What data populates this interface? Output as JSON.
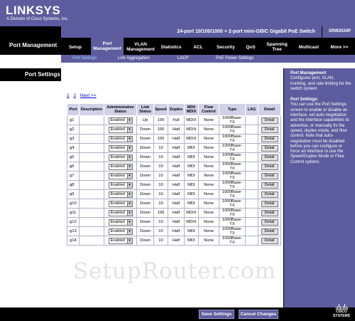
{
  "brand": {
    "logo": "LINKSYS",
    "sub": "A Division of Cisco Systems, Inc."
  },
  "section_title": "Port Management",
  "product": {
    "name": "24-port 10/100/1000 + 2-port mini-GBIC Gigabit PoE Switch",
    "model": "SRW2024P"
  },
  "tabs": [
    "Setup",
    "Port Management",
    "VLAN Management",
    "Statistics",
    "ACL",
    "Security",
    "QoS",
    "Spanning Tree",
    "Multicast",
    "More >>"
  ],
  "subnav": [
    "Port Settings",
    "Link Aggregation",
    "LACP",
    "PoE Power Settings"
  ],
  "page_title": "Port Settings",
  "pager": {
    "p1": "1",
    "p2": "2",
    "next": "Next >>"
  },
  "table": {
    "headers": [
      "Port",
      "Description",
      "Administrative Status",
      "Link Status",
      "Speed",
      "Duplex",
      "MDI/ MDIX",
      "Flow Control",
      "Type",
      "LAG",
      "Detail"
    ],
    "rows": [
      {
        "port": "g1",
        "admin": "Enabled",
        "link": "Up",
        "speed": "100",
        "duplex": "Full",
        "mdi": "MDIX",
        "flow": "None",
        "type": "1000Base-TX",
        "lag": "",
        "detail": "Detail"
      },
      {
        "port": "g2",
        "admin": "Enabled",
        "link": "Down",
        "speed": "100",
        "duplex": "Half",
        "mdi": "MDIX",
        "flow": "None",
        "type": "1000Base-TX",
        "lag": "",
        "detail": "Detail"
      },
      {
        "port": "g3",
        "admin": "Enabled",
        "link": "Down",
        "speed": "100",
        "duplex": "Half",
        "mdi": "MDIX",
        "flow": "None",
        "type": "1000Base-TX",
        "lag": "",
        "detail": "Detail"
      },
      {
        "port": "g4",
        "admin": "Enabled",
        "link": "Down",
        "speed": "10",
        "duplex": "Half",
        "mdi": "MDI",
        "flow": "None",
        "type": "1000Base-TX",
        "lag": "",
        "detail": "Detail"
      },
      {
        "port": "g5",
        "admin": "Enabled",
        "link": "Down",
        "speed": "10",
        "duplex": "Half",
        "mdi": "MDI",
        "flow": "None",
        "type": "1000Base-TX",
        "lag": "",
        "detail": "Detail"
      },
      {
        "port": "g6",
        "admin": "Enabled",
        "link": "Down",
        "speed": "10",
        "duplex": "Half",
        "mdi": "MDI",
        "flow": "None",
        "type": "1000Base-TX",
        "lag": "",
        "detail": "Detail"
      },
      {
        "port": "g7",
        "admin": "Enabled",
        "link": "Down",
        "speed": "10",
        "duplex": "Half",
        "mdi": "MDI",
        "flow": "None",
        "type": "1000Base-TX",
        "lag": "",
        "detail": "Detail"
      },
      {
        "port": "g8",
        "admin": "Enabled",
        "link": "Down",
        "speed": "10",
        "duplex": "Half",
        "mdi": "MDI",
        "flow": "None",
        "type": "1000Base-TX",
        "lag": "",
        "detail": "Detail"
      },
      {
        "port": "g9",
        "admin": "Enabled",
        "link": "Down",
        "speed": "10",
        "duplex": "Half",
        "mdi": "MDI",
        "flow": "None",
        "type": "1000Base-TX",
        "lag": "",
        "detail": "Detail"
      },
      {
        "port": "g10",
        "admin": "Enabled",
        "link": "Down",
        "speed": "10",
        "duplex": "Half",
        "mdi": "MDI",
        "flow": "None",
        "type": "1000Base-TX",
        "lag": "",
        "detail": "Detail"
      },
      {
        "port": "g11",
        "admin": "Enabled",
        "link": "Down",
        "speed": "100",
        "duplex": "Half",
        "mdi": "MDIX",
        "flow": "None",
        "type": "1000Base-TX",
        "lag": "",
        "detail": "Detail"
      },
      {
        "port": "g12",
        "admin": "Enabled",
        "link": "Down",
        "speed": "10",
        "duplex": "Half",
        "mdi": "MDIX",
        "flow": "None",
        "type": "1000Base-TX",
        "lag": "",
        "detail": "Detail"
      },
      {
        "port": "g13",
        "admin": "Enabled",
        "link": "Down",
        "speed": "10",
        "duplex": "Half",
        "mdi": "MDI",
        "flow": "None",
        "type": "1000Base-TX",
        "lag": "",
        "detail": "Detail"
      },
      {
        "port": "g14",
        "admin": "Enabled",
        "link": "Down",
        "speed": "10",
        "duplex": "Half",
        "mdi": "MDI",
        "flow": "None",
        "type": "1000Base-TX",
        "lag": "",
        "detail": "Detail"
      }
    ]
  },
  "help": {
    "title1": "Port Management",
    "text1": "Configures port, VLAN, trunking, and rate limiting for the switch system.",
    "title2": "Port Settings:",
    "text2": "You can use the Port Settings screen to enable or disable an interface, set auto-negotiation and the interface capabilities to advertise, or manually fix the speed, duplex mode, and flow control. Note that auto-negotiation must be disabled before you can configure or force an interface to use the Speed/Duplex Mode or Flow Control options."
  },
  "watermark": "SetupRouter.com",
  "footer": {
    "save": "Save Settings",
    "cancel": "Cancel Changes",
    "cisco": "CISCO SYSTEMS"
  },
  "colors": {
    "primary": "#5c5c9e",
    "header_cell": "#d0d0e8",
    "black": "#000000"
  }
}
